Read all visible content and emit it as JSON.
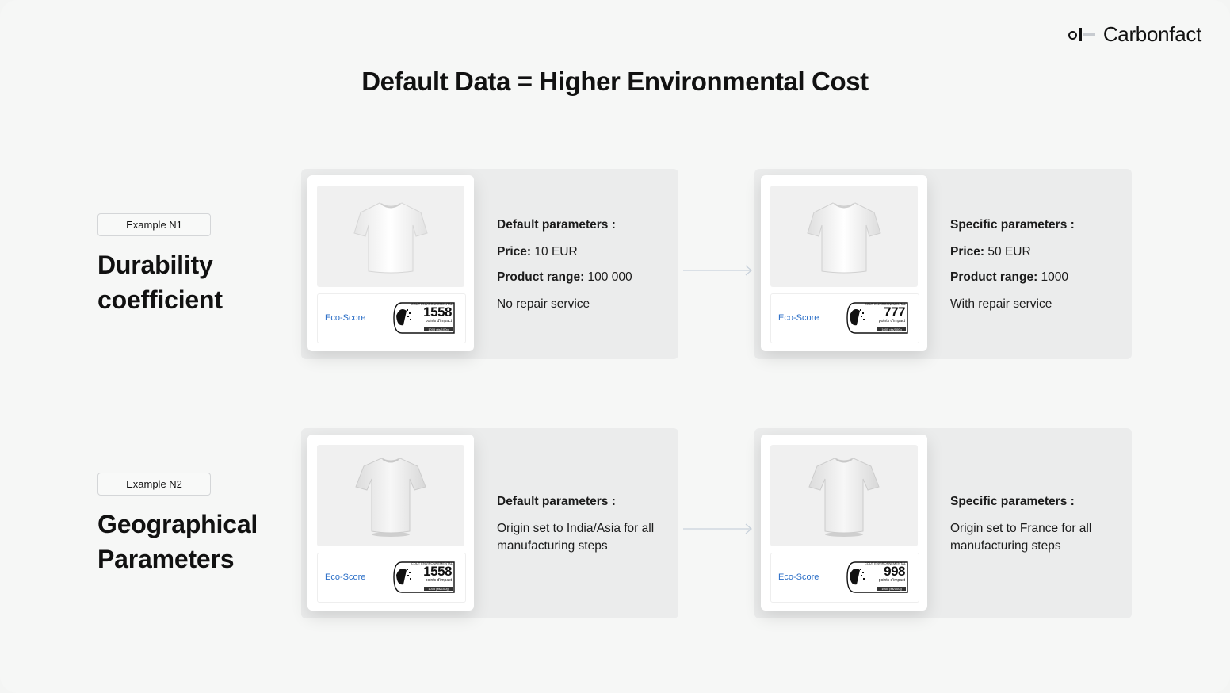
{
  "brand": {
    "name": "Carbonfact"
  },
  "title": "Default Data = Higher Environmental Cost",
  "eco_label": "Eco-Score",
  "tag_small": {
    "top": "COÛT ENVIRONNEMENTAL",
    "sub": "points d'impact",
    "foot": "1005 pts/100g"
  },
  "examples": [
    {
      "badge": "Example N1",
      "title_line1": "Durability",
      "title_line2": "coefficient",
      "default": {
        "heading": "Default parameters :",
        "price_label": "Price:",
        "price_value": " 10 EUR",
        "range_label": "Product range:",
        "range_value": " 100 000",
        "service": "No repair service",
        "score": "1558"
      },
      "specific": {
        "heading": "Specific parameters :",
        "price_label": "Price:",
        "price_value": " 50 EUR",
        "range_label": "Product range:",
        "range_value": " 1000",
        "service": "With repair service",
        "score": "777"
      }
    },
    {
      "badge": "Example N2",
      "title_line1": "Geographical",
      "title_line2": "Parameters",
      "default": {
        "heading": "Default parameters :",
        "origin": "Origin set to India/Asia for all manufacturing steps",
        "score": "1558"
      },
      "specific": {
        "heading": "Specific parameters :",
        "origin": "Origin set to France for all manufacturing steps",
        "score": "998"
      }
    }
  ],
  "icons": {
    "logo": "carbonfact-logo-icon",
    "shirt": "tshirt-icon",
    "arrow": "arrow-right-icon",
    "tag": "eco-tag-icon"
  }
}
